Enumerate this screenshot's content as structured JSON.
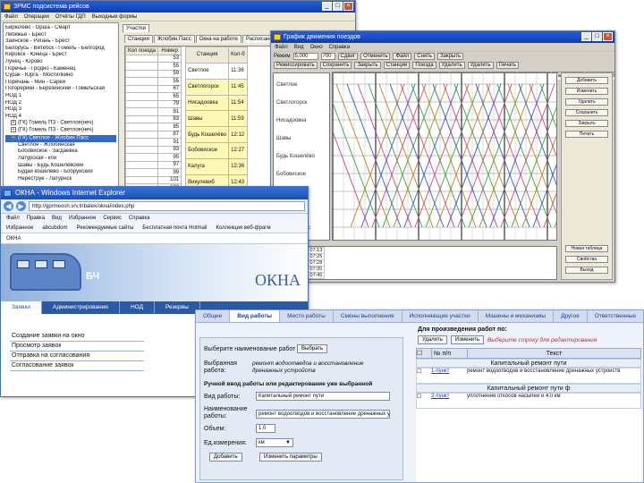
{
  "w1": {
    "title": "ЗРМС подсистема рейсов",
    "menu": [
      "Файл",
      "Операции",
      "Отчёты ГДП",
      "Выходные формы"
    ],
    "tree": [
      {
        "label": "Бирюлёво - Орша - Смарт",
        "sel": false
      },
      {
        "label": "Лебяжье - Брест",
        "sel": false
      },
      {
        "label": "Заинское - Ригань - Брест",
        "sel": false
      },
      {
        "label": "Белорусь - Витебск - Гомель - Белгород",
        "sel": false
      },
      {
        "label": "Кировск - Юница - Брест",
        "sel": false
      },
      {
        "label": "Лунец - Юрово",
        "sel": false
      },
      {
        "label": "Поречье - Гродно - Каменец",
        "sel": false
      },
      {
        "label": "Сурак - Юрга - Мостилкино",
        "sel": false
      },
      {
        "label": "Поречань - Мин - Сарей",
        "sel": false
      },
      {
        "label": "Погорерики - Березинский - Гомельская",
        "sel": false
      },
      {
        "label": "НОД 1",
        "sel": false
      },
      {
        "label": "НОД 2",
        "sel": false
      },
      {
        "label": "НОД 3",
        "sel": false
      },
      {
        "label": "НОД 4",
        "sel": false
      },
      {
        "label": "(ГК) Гомель ПЗ - Светлое(неч)",
        "sel": false
      },
      {
        "label": "(ГК) Гомель ПЗ - Светлое(неч)",
        "sel": false
      },
      {
        "label": "(ГК) Светлое - Жлобин Пасс",
        "sel": true
      },
      {
        "label": "Светлое - Жлобинская",
        "sel": false
      },
      {
        "label": "Бобовиское - Загдаевка",
        "sel": false
      },
      {
        "label": "Латурская - кпи",
        "sel": false
      },
      {
        "label": "Шавы - Будь Кошелёвские",
        "sel": false
      },
      {
        "label": "Будай кошелёво - Бобруйский",
        "sel": false
      },
      {
        "label": "Нереструе - Латурнск",
        "sel": false
      }
    ],
    "tab": "Участки",
    "sub_tabs": [
      "Станции",
      "Жлобин Пасс",
      "Окна на работе",
      "Расписание",
      "Пр"
    ],
    "cols": [
      "Кол поезда",
      "Номер"
    ],
    "train_nums": [
      "53",
      "55",
      "59",
      "55",
      "67",
      "65",
      "79",
      "81",
      "83",
      "85",
      "87",
      "91",
      "93",
      "95",
      "97",
      "99",
      "101",
      "103",
      "105",
      "107"
    ],
    "station_cols": [
      "Станция",
      "Кол-б"
    ],
    "stations": [
      {
        "name": "Светлое",
        "time": "11:36"
      },
      {
        "name": "Светлогорск",
        "time": "11:45"
      },
      {
        "name": "Нисадоовка",
        "time": "11:54"
      },
      {
        "name": "Шавы",
        "time": "11:59"
      },
      {
        "name": "Будь Кошелёво",
        "time": "12:12"
      },
      {
        "name": "Бобовиское",
        "time": "12:27"
      },
      {
        "name": "Калуга",
        "time": "12:36"
      },
      {
        "name": "Викулевиб",
        "time": "12:43"
      },
      {
        "name": "Жлобин Пасс",
        "time": "12:50"
      }
    ]
  },
  "w2": {
    "title": "График движения поездов",
    "menu": [
      "Файл",
      "Вид",
      "Окно",
      "Справка"
    ],
    "tb1": [
      "Режим",
      "5,000",
      "700",
      "Сдвиг",
      "Отменить",
      "Файл",
      "Снять",
      "Закрыть"
    ],
    "tb2": [
      "Режиссировать",
      "Сохранить",
      "Закрыть",
      "Станции",
      "Поезда",
      "Удалить",
      "Удалить",
      "Печать"
    ],
    "tabs": [
      "Все",
      "TabSheet1",
      "TabSheet2",
      "TabSheet3",
      "TabSheet4",
      "TabSheet5",
      "TabSheet6",
      "TabSheet7",
      "TabSheet8",
      "TabSheet9"
    ],
    "stations": [
      "Светлое",
      "Светлогорск",
      "Нисадоовка",
      "Шавы",
      "Будь Кошелёво",
      "Бобовиское",
      "Калуга",
      "Викулевиб",
      "Жлобин Пасс"
    ],
    "side_buttons": [
      "Добавить",
      "Изменить",
      "Удалить",
      "Сохранить",
      "Закрыть",
      "Печать"
    ],
    "bottom_rows": [
      [
        "97 00",
        "07:10",
        "07:13"
      ],
      [
        "97 09",
        "07:19",
        "07:25"
      ],
      [
        "97 11",
        "07:26",
        "07:28"
      ],
      [
        "97 17",
        "07:31",
        "07:35"
      ],
      [
        "97 23",
        "07:38",
        "07:45"
      ]
    ],
    "bottom_btns": [
      "Новая таблица",
      "Свойства",
      "Выход"
    ]
  },
  "w3": {
    "title": "ОКНА - Windows Internet Explorer",
    "address": "http://gprmeosh.srv.tribalex/okna/index.php",
    "menu": [
      "Файл",
      "Правка",
      "Вид",
      "Избранное",
      "Сервис",
      "Справка"
    ],
    "favorites": [
      "Избранное",
      "abcubdom",
      "Рекомендуемые сайты",
      "Бесплатная почта Hotmail",
      "Коллекция веб-фрагм"
    ],
    "page_tab": "ОКНА",
    "logo": "БЧ",
    "banner_title": "ОКНА",
    "nav": [
      "Заявки",
      "Администрирование",
      "НОД",
      "Резервы"
    ],
    "submenu": [
      "Создание заявки на окно",
      "Просмотр заявок",
      "Отправка на согласования",
      "Согласование заявок"
    ]
  },
  "w4": {
    "tabs": [
      "Общее",
      "Вид работы",
      "Место работы",
      "Смены выполнения",
      "Исполняющие участки",
      "Машины и механизмы",
      "Другое",
      "Ответственные",
      "Согл"
    ],
    "select_label": "Выберите наименование работ",
    "select_btn": "Выбрать",
    "selected_label": "Выбранная работа:",
    "selected_value": "ремонт водоотведов и восстановление дренажных устройств",
    "manual_label": "Ручной ввод работы или редактирование уже выбранной",
    "kind_label": "Вид работы:",
    "kind_value": "Капитальный ремонт пути",
    "name_label": "Наименование работы:",
    "name_value": "ремонт водоотводов и восстановление дренажных устр",
    "volume_label": "Объем:",
    "volume_value": "1.0",
    "unit_label": "Ед.измерения:",
    "unit_value": "км",
    "add_btn": "Добавить",
    "change_btn": "Изменить параметры",
    "right_header": "Для произведения работ по:",
    "delete_btn": "Удалить",
    "edit_btn": "Изменить",
    "hint": "Выберите строку для редактирования",
    "col_num": "№ п/п",
    "col_text": "Текст",
    "rows": [
      {
        "category": "Капитальный ремонт пути",
        "num": "1-пункт",
        "text": "ремонт водоотводов и восстановление дренажных устройств"
      },
      {
        "category": "Капитальный ремонт пути ф",
        "num": "2-пункт",
        "text": "уплотнение откосов насыпей и 4.0 км"
      }
    ]
  }
}
